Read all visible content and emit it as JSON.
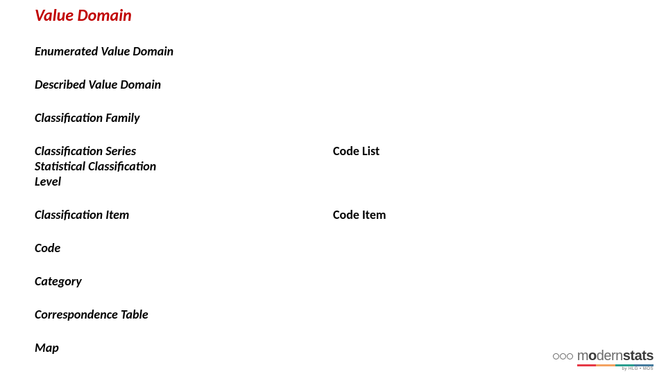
{
  "title": "Value Domain",
  "leftItems": [
    "Enumerated Value Domain",
    "Described Value Domain",
    "Classification Family"
  ],
  "rows": [
    {
      "leftLines": [
        "Classification Series",
        "Statistical Classification",
        "Level"
      ],
      "right": "Code List"
    },
    {
      "leftLines": [
        "Classification Item"
      ],
      "right": "Code Item"
    }
  ],
  "tail": [
    "Code",
    "Category",
    "Correspondence Table",
    "Map"
  ],
  "logo": {
    "light": "m",
    "bold1": "o",
    "light2": "dern",
    "bold2": "stats",
    "sub": "by HLG • MOS"
  }
}
